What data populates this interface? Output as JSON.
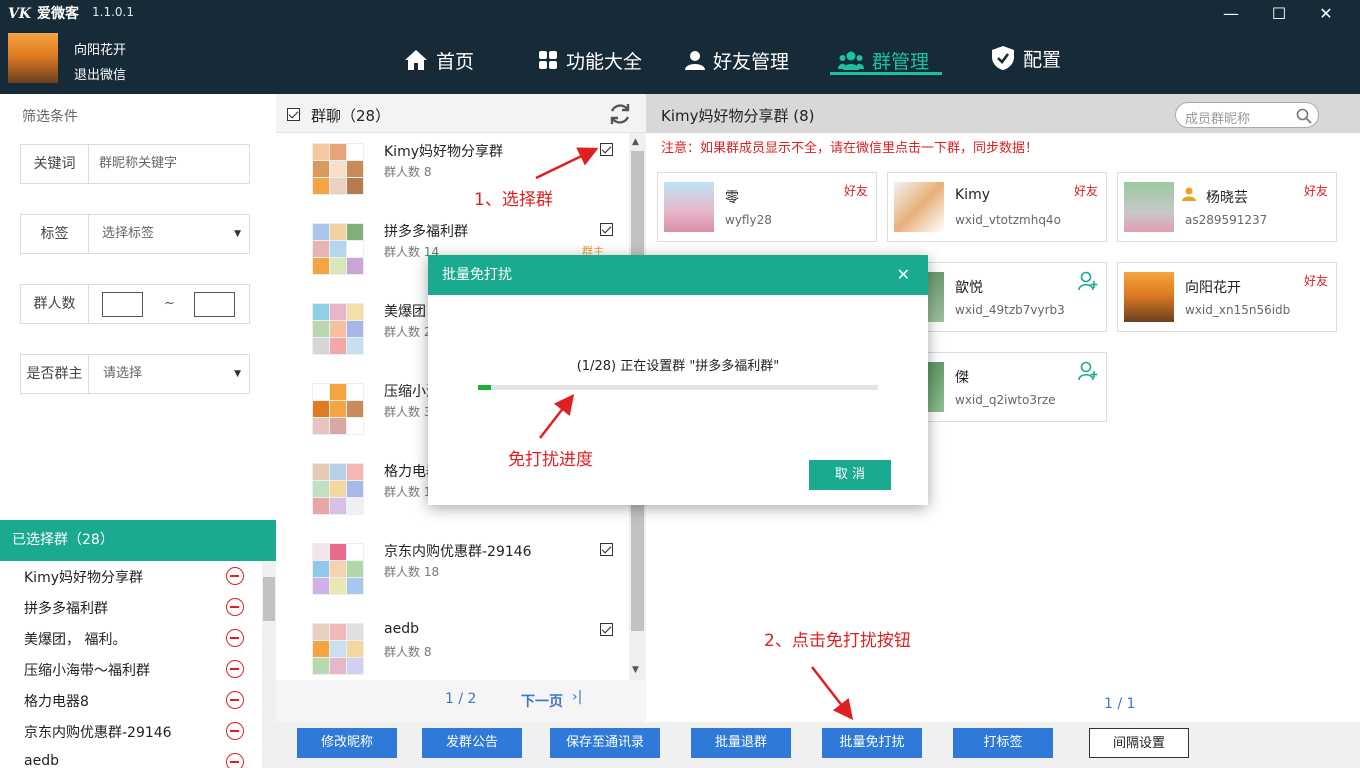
{
  "app": {
    "title": "爱微客",
    "logo_mark": "VK",
    "version": "1.1.0.1"
  },
  "user": {
    "name": "向阳花开",
    "logout": "退出微信"
  },
  "nav": [
    {
      "label": "首页",
      "icon": "home-icon"
    },
    {
      "label": "功能大全",
      "icon": "grid-icon"
    },
    {
      "label": "好友管理",
      "icon": "user-icon"
    },
    {
      "label": "群管理",
      "icon": "group-icon",
      "active": true
    },
    {
      "label": "配置",
      "icon": "shield-icon"
    }
  ],
  "filters": {
    "title": "筛选条件",
    "keyword": {
      "label": "关键词",
      "placeholder": "群昵称关键字"
    },
    "tag": {
      "label": "标签",
      "value": "选择标签"
    },
    "members": {
      "label": "群人数",
      "separator": "~"
    },
    "owner": {
      "label": "是否群主",
      "value": "请选择"
    }
  },
  "selected": {
    "header": "已选择群（28）",
    "items": [
      "Kimy妈好物分享群",
      "拼多多福利群",
      "美爆团，   福利。",
      "压缩小海带～福利群",
      "格力电器8",
      "京东内购优惠群-29146",
      "aedb"
    ]
  },
  "group_list": {
    "title": "群聊（28）",
    "items": [
      {
        "name": "Kimy妈好物分享群",
        "count": "群人数 8"
      },
      {
        "name": "拼多多福利群",
        "count": "群人数 14",
        "badge": "群主"
      },
      {
        "name": "美爆团",
        "count": "群人数 2"
      },
      {
        "name": "压缩小海",
        "count": "群人数 3"
      },
      {
        "name": "格力电器",
        "count": "群人数 1"
      },
      {
        "name": "京东内购优惠群-29146",
        "count": "群人数 18"
      },
      {
        "name": "aedb",
        "count": "群人数 8"
      }
    ],
    "pager": {
      "page": "1 / 2",
      "next": "下一页"
    }
  },
  "detail": {
    "title": "Kimy妈好物分享群  (8)",
    "search_placeholder": "成员群昵称",
    "notice": "注意：如果群成员显示不全，请在微信里点击一下群，同步数据！",
    "members": [
      {
        "name": "零",
        "id": "wyfly28",
        "badge": "好友"
      },
      {
        "name": "Kimy",
        "id": "wxid_vtotzmhq4o",
        "badge": "好友"
      },
      {
        "name": "杨晓芸",
        "id": "as289591237",
        "badge": "好友"
      },
      {
        "name": "歆悦",
        "id": "wxid_49tzb7vyrb3"
      },
      {
        "name": "向阳花开",
        "id": "wxid_xn15n56idb",
        "badge": "好友"
      },
      {
        "name": "傑",
        "id": "wxid_q2iwto3rze"
      }
    ],
    "pager": "1 / 1"
  },
  "buttons": [
    "修改昵称",
    "发群公告",
    "保存至通讯录",
    "批量退群",
    "批量免打扰",
    "打标签",
    "间隔设置"
  ],
  "dialog": {
    "title": "批量免打扰",
    "message": "(1/28) 正在设置群 \"拼多多福利群\"",
    "progress": 0.033,
    "cancel": "取 消"
  },
  "annotations": {
    "step1": "1、选择群",
    "progress": "免打扰进度",
    "step2": "2、点击免打扰按钮"
  },
  "colors": {
    "topbar": "#172a38",
    "accent": "#1bc1a2",
    "button_blue": "#2f7ad8",
    "annotation_red": "#e02020"
  }
}
